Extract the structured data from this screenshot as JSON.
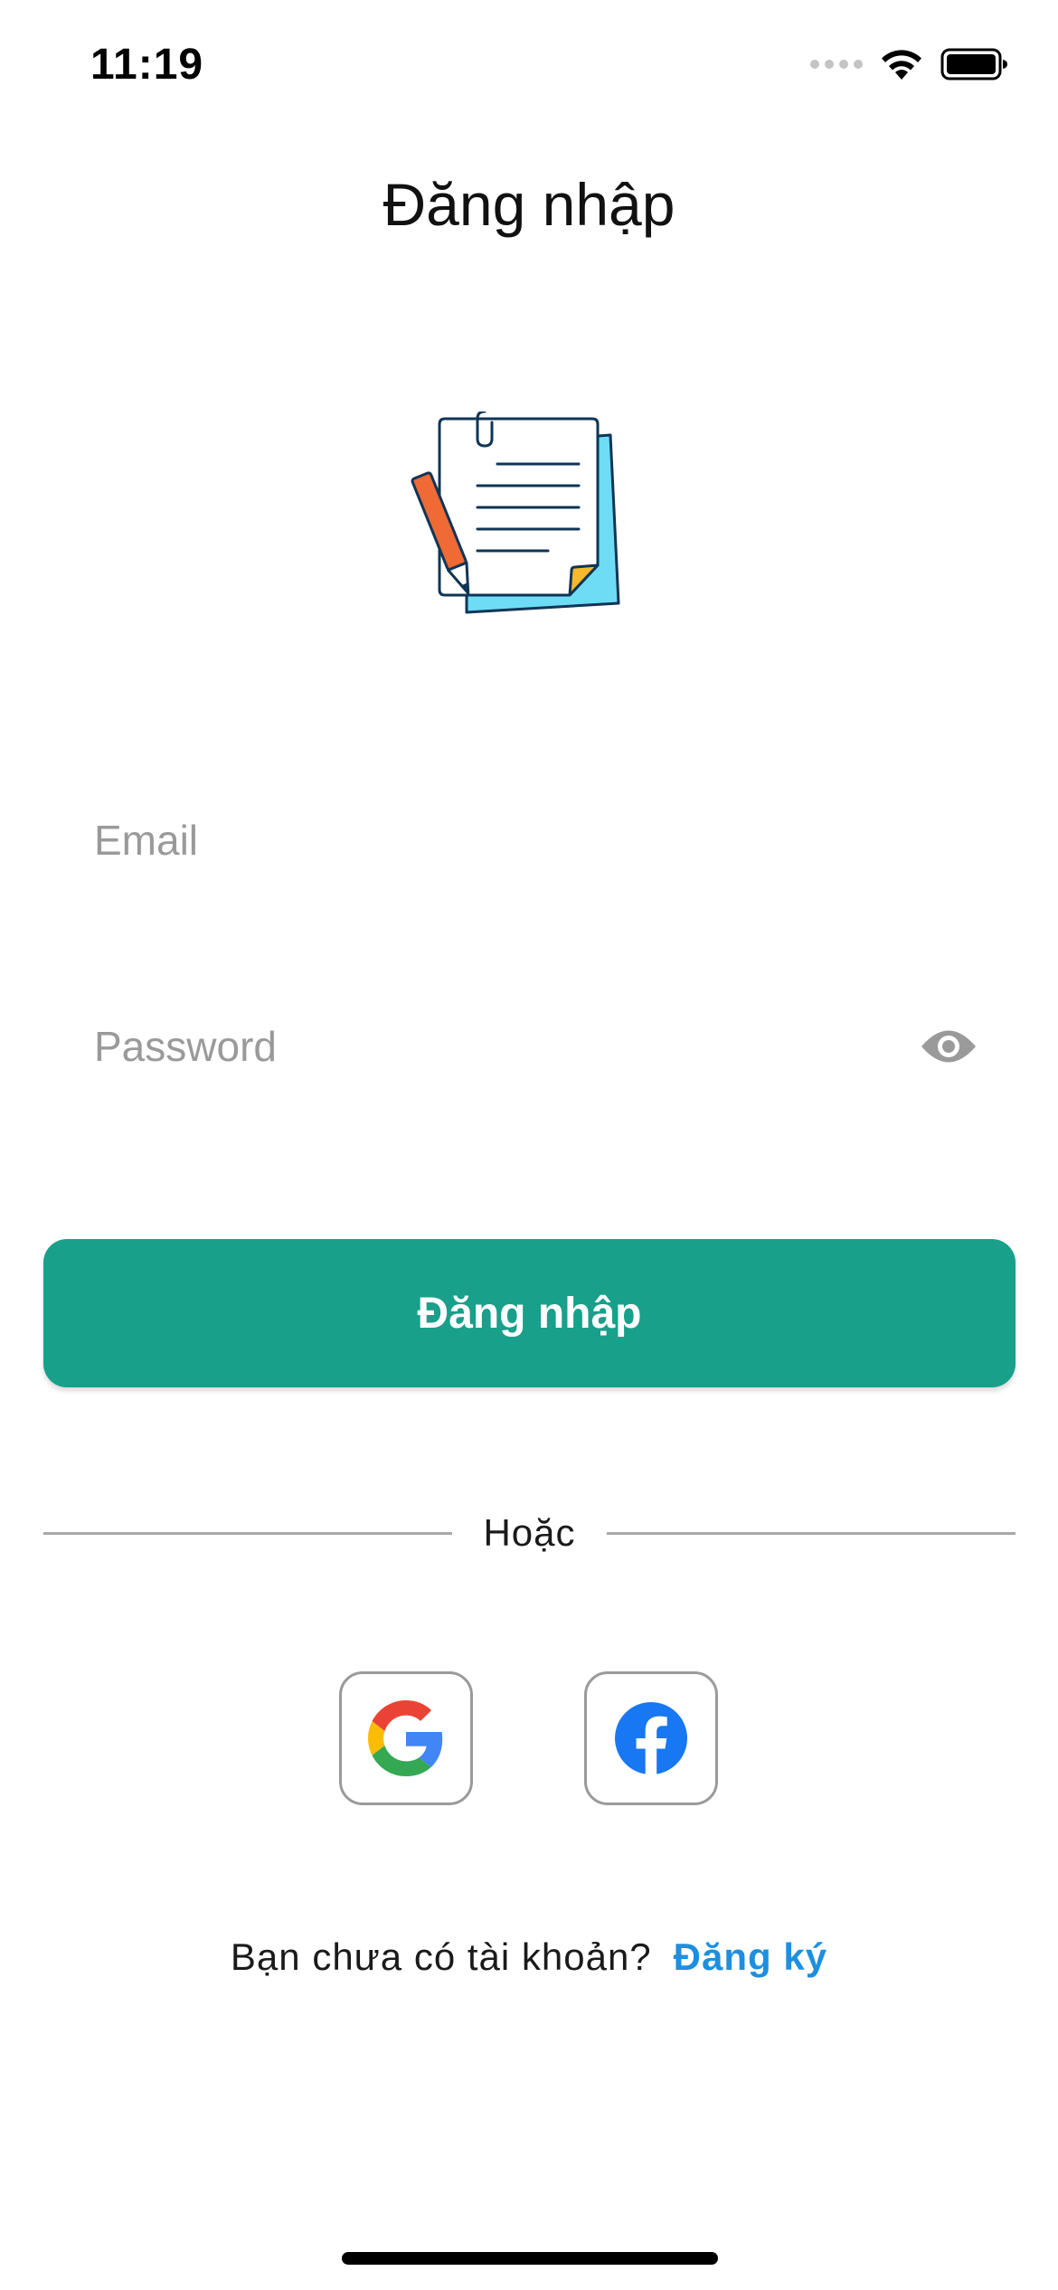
{
  "status_bar": {
    "time": "11:19",
    "icons": [
      "signal-dots-icon",
      "wifi-icon",
      "battery-icon"
    ]
  },
  "header": {
    "title": "Đăng nhập"
  },
  "illustration": {
    "icon": "notes-with-pencil-icon"
  },
  "form": {
    "email_placeholder": "Email",
    "email_value": "",
    "password_placeholder": "Password",
    "password_value": "",
    "password_toggle_icon": "eye-icon",
    "submit_label": "Đăng nhập"
  },
  "divider": {
    "label": "Hoặc"
  },
  "social": {
    "google_icon": "google-icon",
    "facebook_icon": "facebook-icon"
  },
  "signup": {
    "prompt": "Bạn chưa có tài khoản?",
    "link_label": "Đăng ký"
  },
  "colors": {
    "primary": "#18a08b",
    "link": "#1e8fe0",
    "placeholder": "#9a9a9a",
    "divider": "#a8a8a8"
  }
}
